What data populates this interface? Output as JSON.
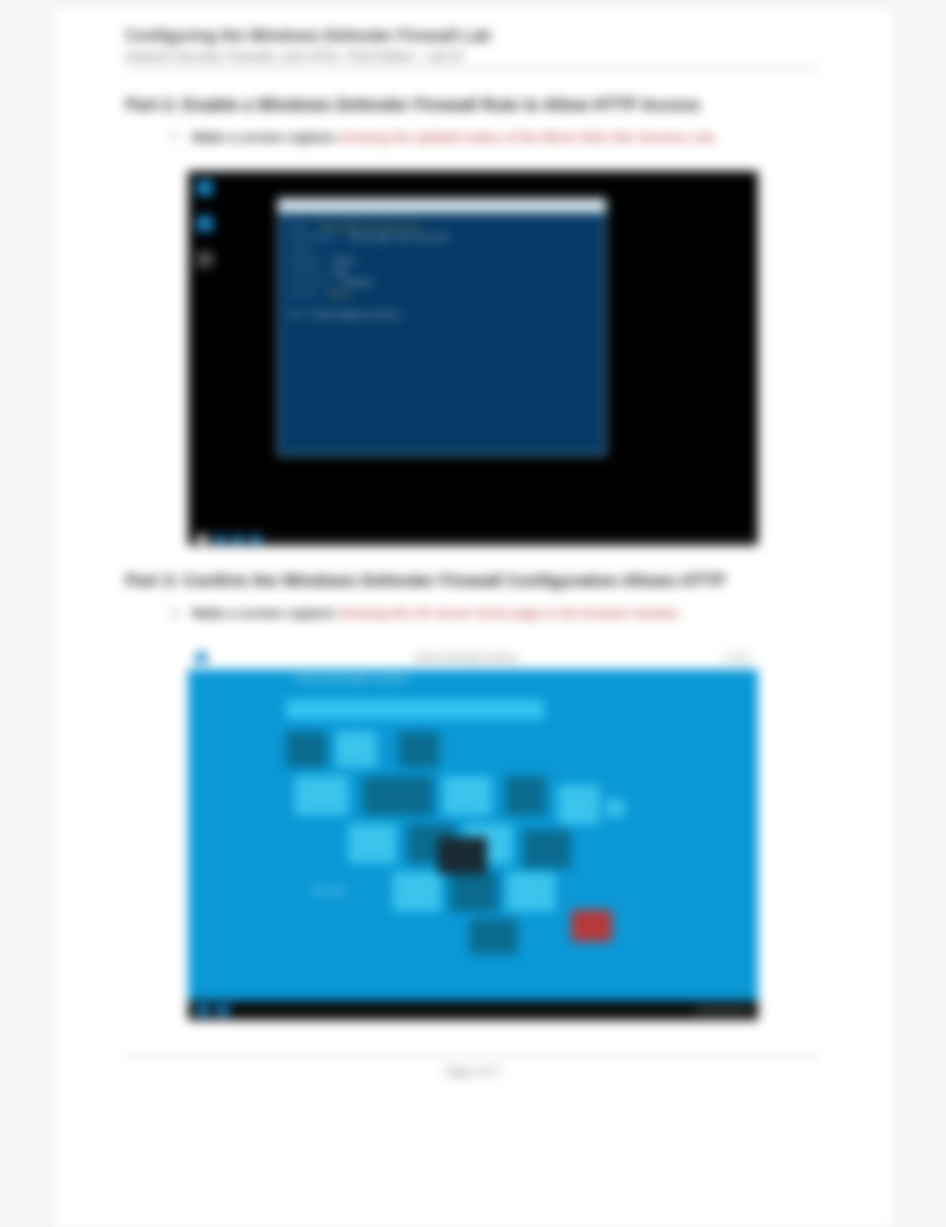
{
  "header": {
    "title": "Configuring the Windows Defender Firewall Lab",
    "subtitle": "Network Security, Firewalls, and VPNs, Third Edition - Lab 02"
  },
  "part2": {
    "heading": "Part 2: Enable a Windows Defender Firewall Rule to Allow HTTP Access",
    "item_num": "7.",
    "item_lead": "Make a screen capture",
    "item_rest": " showing the updated status of the Block Web Site Services rule."
  },
  "part3": {
    "heading": "Part 3: Confirm the Windows Defender Firewall Configuration Allows HTTP",
    "item_num": "3.",
    "item_lead": "Make a screen capture",
    "item_rest": " showing the IIS server home page in the browser window."
  },
  "ps": {
    "line1a": "Name                 : ",
    "line1b": "Block Web Site Services",
    "line1c": "",
    "line2a": "DisplayName          : ",
    "line2b": "Block Web Site Services",
    "line3a": "Group                : ",
    "line4a": "Enabled              : ",
    "line4b": "False",
    "line5a": "Profile              : ",
    "line5b": "Any",
    "line6a": "Direction            : ",
    "line6b": "Inbound",
    "line7a": "Action               : ",
    "line7b": "Block",
    "prompt": "PS C:\\Users\\Administrator> "
  },
  "iis": {
    "url": "Internet Information Services",
    "label": "Internet Information Services",
    "welcome": "Welcome",
    "caption": "Microsoft"
  },
  "footer": {
    "text": "Page 4 of 7"
  }
}
